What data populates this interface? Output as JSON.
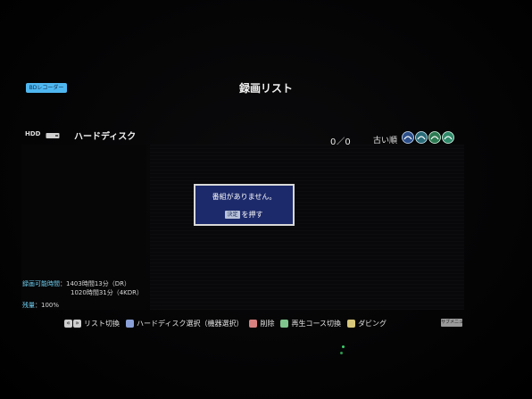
{
  "header": {
    "recorder_badge": "BDレコーダー",
    "title": "録画リスト"
  },
  "drive": {
    "type_label": "HDD",
    "name": "ハードディスク"
  },
  "list": {
    "count": "0／0",
    "sort_label": "古い順",
    "genre_icons": [
      "genre-icon-1",
      "genre-icon-2",
      "genre-icon-3",
      "genre-icon-4"
    ]
  },
  "dialog": {
    "message": "番組がありません。",
    "key_label": "決定",
    "hint": "を押す"
  },
  "status": {
    "rec_time_label": "録画可能時間",
    "rec_time_dr": "：1403時間13分（DR）",
    "rec_time_4kdr": "1020時間31分（4KDR）",
    "remaining_label": "残量",
    "remaining_value": "：100%"
  },
  "footer": {
    "list_switch": "リスト切換",
    "hdd_select": "ハードディスク選択（機器選択）",
    "delete": "削除",
    "playback_course": "再生コース切換",
    "dubbing": "ダビング",
    "submenu_badge": "サブメニュー"
  },
  "colors": {
    "dialog_bg": "#1c2a6b",
    "accent_cyan": "#6fd0f2",
    "badge_blue": "#4fb7f0"
  }
}
